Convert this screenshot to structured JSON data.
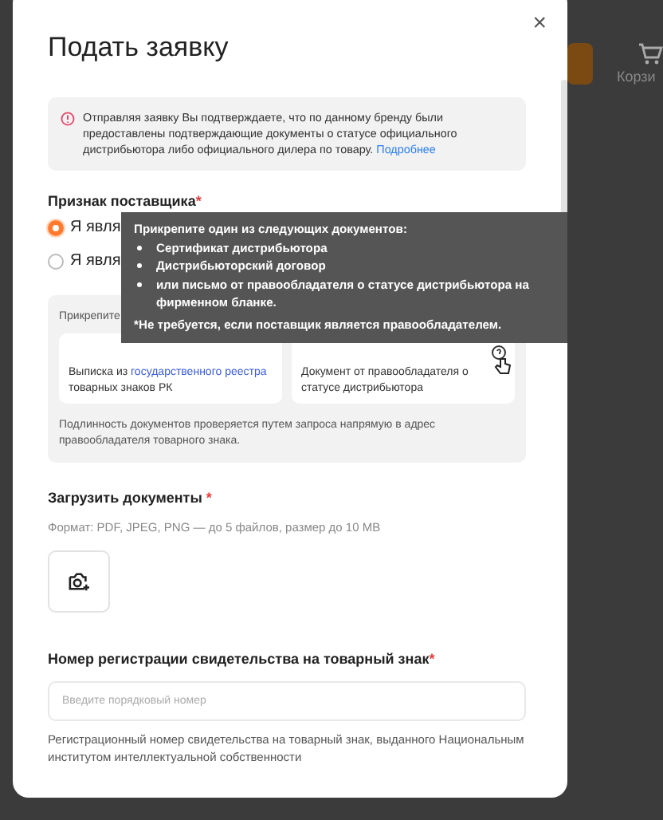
{
  "background": {
    "cart_label": "Корзи"
  },
  "dialog": {
    "title": "Подать заявку",
    "close": "×",
    "notice": {
      "text": "Отправляя заявку Вы подтверждаете, что по данному бренду были предоставлены подтверждающие документы о статусе официального дистрибьютора либо официального дилера по товару.",
      "link": "Подробнее"
    },
    "supplier": {
      "label": "Признак поставщика",
      "required_mark": "*",
      "options": [
        {
          "parts": [
            "Я явля"
          ],
          "selected": true
        },
        {
          "parts": [
            "Я явля"
          ],
          "selected": false
        }
      ]
    },
    "documents": {
      "heading": "Прикрепите",
      "cards": [
        {
          "before": "Выписка из ",
          "link": "государственного реестра",
          "after": " товарных знаков РК",
          "help": false
        },
        {
          "before": "Документ от правообладателя о статусе дистрибьютора",
          "help": true
        }
      ],
      "note": "Подлинность документов проверяется путем запроса напрямую в адрес правообладателя товарного знака."
    },
    "upload": {
      "label": "Загрузить документы",
      "required_mark": "*",
      "hint": "Формат: PDF, JPEG, PNG — до 5 файлов, размер до 10 MB"
    },
    "registration": {
      "label": "Номер регистрации свидетельства на товарный знак",
      "required_mark": "*",
      "placeholder": "Введите порядковый номер",
      "help": "Регистрационный номер свидетельства на товарный знак, выданного Национальным институтом интеллектуальной собственности"
    }
  },
  "tooltip": {
    "title": "Прикрепите один из следующих документов:",
    "items": [
      "Сертификат дистрибьютора",
      "Дистрибьюторский договор",
      "или письмо от правообладателя о статусе дистрибьютора на фирменном бланке."
    ],
    "note": "*Не требуется, если поставщик является правообладателем."
  }
}
